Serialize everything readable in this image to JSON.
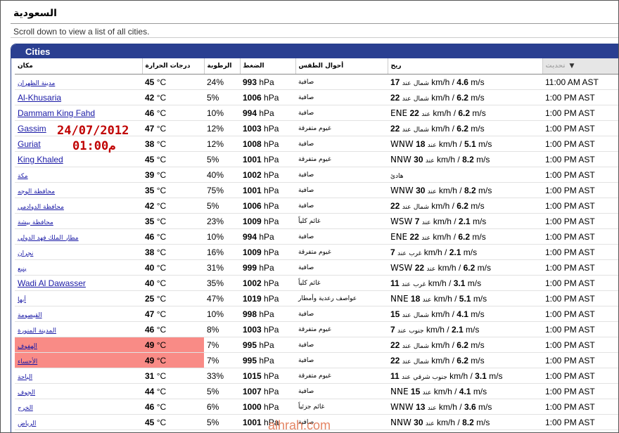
{
  "header": {
    "title": "السعودية",
    "subtitle": "Scroll down to view a list of all cities."
  },
  "panel": {
    "title": "Cities"
  },
  "columns": {
    "place": "مكان",
    "temp": "درجات الحرارة",
    "humidity": "الرطوبة",
    "pressure": "الضغط",
    "condition": "أحوال الطقس",
    "wind": "ريح",
    "updated": "تحديث"
  },
  "units": {
    "temp": "°C",
    "pressure": "hPa",
    "kmh": "km/h",
    "ms": "m/s",
    "at": "عند"
  },
  "rows": [
    {
      "city": "مدينة الظهران",
      "temp": "45",
      "humidity": "24%",
      "pressure": "993",
      "condition": "صافية",
      "wind_dir": "شمال",
      "wind_kmh": "17",
      "wind_ms": "4.6",
      "time": "11:00 AM AST"
    },
    {
      "city": "Al-Khusaria",
      "temp": "42",
      "humidity": "5%",
      "pressure": "1006",
      "condition": "صافية",
      "wind_dir": "شمال",
      "wind_kmh": "22",
      "wind_ms": "6.2",
      "time": "1:00 PM AST"
    },
    {
      "city": "Dammam King Fahd",
      "temp": "46",
      "humidity": "10%",
      "pressure": "994",
      "condition": "صافية",
      "wind_dir": "ENE",
      "wind_kmh": "22",
      "wind_ms": "6.2",
      "time": "1:00 PM AST"
    },
    {
      "city": "Gassim",
      "temp": "47",
      "humidity": "12%",
      "pressure": "1003",
      "condition": "غيوم متفرقة",
      "wind_dir": "شمال",
      "wind_kmh": "22",
      "wind_ms": "6.2",
      "time": "1:00 PM AST"
    },
    {
      "city": "Guriat",
      "temp": "38",
      "humidity": "12%",
      "pressure": "1008",
      "condition": "صافية",
      "wind_dir": "WNW",
      "wind_kmh": "18",
      "wind_ms": "5.1",
      "time": "1:00 PM AST"
    },
    {
      "city": "King Khaled",
      "temp": "45",
      "humidity": "5%",
      "pressure": "1001",
      "condition": "غيوم متفرقة",
      "wind_dir": "NNW",
      "wind_kmh": "30",
      "wind_ms": "8.2",
      "time": "1:00 PM AST"
    },
    {
      "city": "مكة",
      "temp": "39",
      "humidity": "40%",
      "pressure": "1002",
      "condition": "صافية",
      "wind_text": "هادئ",
      "time": "1:00 PM AST"
    },
    {
      "city": "محافظة الوجه",
      "temp": "35",
      "humidity": "75%",
      "pressure": "1001",
      "condition": "صافية",
      "wind_dir": "WNW",
      "wind_kmh": "30",
      "wind_ms": "8.2",
      "time": "1:00 PM AST"
    },
    {
      "city": "محافظة الدوادمي",
      "temp": "42",
      "humidity": "5%",
      "pressure": "1006",
      "condition": "صافية",
      "wind_dir": "شمال",
      "wind_kmh": "22",
      "wind_ms": "6.2",
      "time": "1:00 PM AST"
    },
    {
      "city": "محافظة بيشة",
      "temp": "35",
      "humidity": "23%",
      "pressure": "1009",
      "condition": "غائم كلياً",
      "wind_dir": "WSW",
      "wind_kmh": "7",
      "wind_ms": "2.1",
      "time": "1:00 PM AST"
    },
    {
      "city": "مطار الملك فهد الدولي",
      "temp": "46",
      "humidity": "10%",
      "pressure": "994",
      "condition": "صافية",
      "wind_dir": "ENE",
      "wind_kmh": "22",
      "wind_ms": "6.2",
      "time": "1:00 PM AST"
    },
    {
      "city": "نجران",
      "temp": "38",
      "humidity": "16%",
      "pressure": "1009",
      "condition": "غيوم متفرقة",
      "wind_dir": "غرب",
      "wind_kmh": "7",
      "wind_ms": "2.1",
      "time": "1:00 PM AST"
    },
    {
      "city": "ينبع",
      "temp": "40",
      "humidity": "31%",
      "pressure": "999",
      "condition": "صافية",
      "wind_dir": "WSW",
      "wind_kmh": "22",
      "wind_ms": "6.2",
      "time": "1:00 PM AST"
    },
    {
      "city": "Wadi Al Dawasser",
      "temp": "40",
      "humidity": "35%",
      "pressure": "1002",
      "condition": "غائم كلياً",
      "wind_dir": "غرب",
      "wind_kmh": "11",
      "wind_ms": "3.1",
      "time": "1:00 PM AST"
    },
    {
      "city": "أبها",
      "temp": "25",
      "humidity": "47%",
      "pressure": "1019",
      "condition": "عواصف رعدية وأمطار",
      "wind_dir": "NNE",
      "wind_kmh": "18",
      "wind_ms": "5.1",
      "time": "1:00 PM AST"
    },
    {
      "city": "القيصومة",
      "temp": "47",
      "humidity": "10%",
      "pressure": "998",
      "condition": "صافية",
      "wind_dir": "شمال",
      "wind_kmh": "15",
      "wind_ms": "4.1",
      "time": "1:00 PM AST"
    },
    {
      "city": "المدينة المنورة",
      "temp": "46",
      "humidity": "8%",
      "pressure": "1003",
      "condition": "غيوم متفرقة",
      "wind_dir": "جنوب",
      "wind_kmh": "7",
      "wind_ms": "2.1",
      "time": "1:00 PM AST"
    },
    {
      "city": "الهفوف",
      "temp": "49",
      "humidity": "7%",
      "pressure": "995",
      "condition": "صافية",
      "wind_dir": "شمال",
      "wind_kmh": "22",
      "wind_ms": "6.2",
      "time": "1:00 PM AST",
      "highlight": true
    },
    {
      "city": "الأحساء",
      "temp": "49",
      "humidity": "7%",
      "pressure": "995",
      "condition": "صافية",
      "wind_dir": "شمال",
      "wind_kmh": "22",
      "wind_ms": "6.2",
      "time": "1:00 PM AST",
      "highlight": true
    },
    {
      "city": "الباحة",
      "temp": "31",
      "humidity": "33%",
      "pressure": "1015",
      "condition": "غيوم متفرقة",
      "wind_dir": "جنوب شرقي",
      "wind_kmh": "11",
      "wind_ms": "3.1",
      "time": "1:00 PM AST"
    },
    {
      "city": "الجوف",
      "temp": "44",
      "humidity": "5%",
      "pressure": "1007",
      "condition": "صافية",
      "wind_dir": "NNE",
      "wind_kmh": "15",
      "wind_ms": "4.1",
      "time": "1:00 PM AST"
    },
    {
      "city": "الخرج",
      "temp": "46",
      "humidity": "6%",
      "pressure": "1000",
      "condition": "غائم جزئياً",
      "wind_dir": "WNW",
      "wind_kmh": "13",
      "wind_ms": "3.6",
      "time": "1:00 PM AST"
    },
    {
      "city": "الرياض",
      "temp": "45",
      "humidity": "5%",
      "pressure": "1001",
      "condition": "صافية",
      "wind_dir": "NNW",
      "wind_kmh": "30",
      "wind_ms": "8.2",
      "time": "1:00 PM AST"
    }
  ],
  "annotation": {
    "date": "24/07/2012",
    "time": "01:00م"
  },
  "watermark": "alhrah.com",
  "colors": {
    "panel_header": "#2a3f91",
    "highlight": "#f98b86",
    "link": "#1a1aa6",
    "annotation": "#c00000"
  }
}
